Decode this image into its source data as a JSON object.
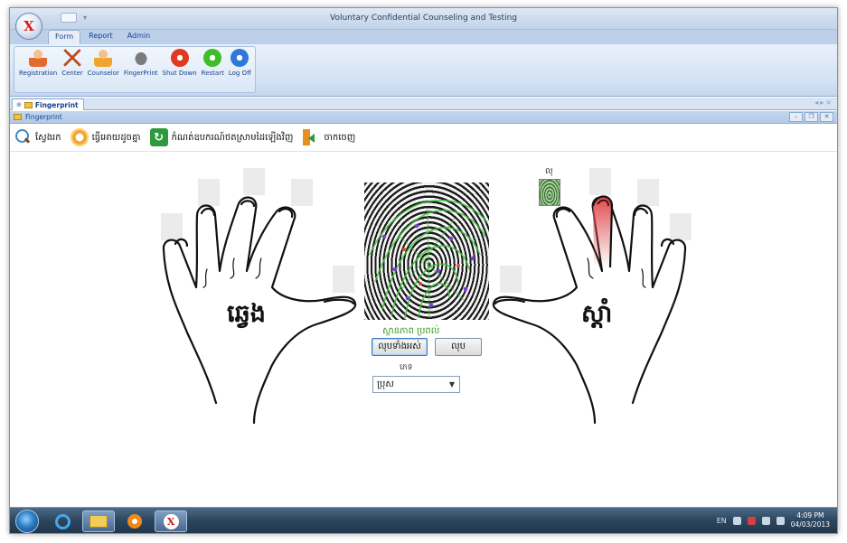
{
  "window": {
    "title": "Voluntary Confidential Counseling and Testing"
  },
  "ribbon": {
    "tabs": [
      "Form",
      "Report",
      "Admin"
    ],
    "active_tab": "Form",
    "buttons": [
      {
        "label": "Registration",
        "icon": "registration-icon"
      },
      {
        "label": "Center",
        "icon": "center-icon"
      },
      {
        "label": "Counselor",
        "icon": "counselor-icon"
      },
      {
        "label": "FingerPrint",
        "icon": "fingerprint-icon"
      },
      {
        "label": "Shut Down",
        "icon": "shutdown-icon"
      },
      {
        "label": "Restart",
        "icon": "restart-icon"
      },
      {
        "label": "Log Off",
        "icon": "logoff-icon"
      }
    ]
  },
  "document_tab": {
    "label": "Fingerprint"
  },
  "child_window": {
    "title": "Fingerprint"
  },
  "toolbar": {
    "search": "ស្វែងរក",
    "compare": "ធ្វើអោយដូចគ្នា",
    "rescan": "កំណត់ឧបករណ៍ថតស្រាមដៃឡើងវិញ",
    "exit": "ចាកចេញ"
  },
  "fingerprint_form": {
    "left_hand_label": "ឆ្វេង",
    "right_hand_label": "ស្តាំ",
    "thumbnail_label": "លុ",
    "status": "ស្ថានភាព ប្រពល់",
    "clear_all_button": "លុបទាំងអស់",
    "clear_button": "លុប",
    "gender_label": "ភេទ",
    "gender_selected": "ប្រុស",
    "selected_finger": "right-middle",
    "highlight_color": "#e0494e",
    "minutiae_color": "#3cc23a"
  },
  "taskbar": {
    "language": "EN",
    "time": "4:09 PM",
    "date": "04/03/2013"
  }
}
